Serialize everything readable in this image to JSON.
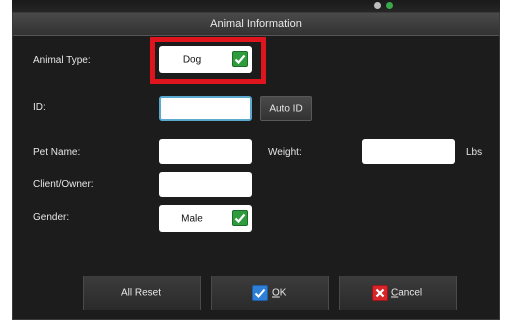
{
  "dialog": {
    "title": "Animal Information"
  },
  "labels": {
    "animal_type": "Animal Type:",
    "id": "ID:",
    "pet_name": "Pet Name:",
    "weight": "Weight:",
    "weight_unit": "Lbs",
    "client_owner": "Client/Owner:",
    "gender": "Gender:"
  },
  "fields": {
    "animal_type_value": "Dog",
    "id_value": "",
    "pet_name_value": "",
    "weight_value": "",
    "client_owner_value": "",
    "gender_value": "Male"
  },
  "buttons": {
    "auto_id": "Auto ID",
    "all_reset": "All Reset",
    "ok_accel": "O",
    "ok_rest": "K",
    "cancel_accel": "C",
    "cancel_rest": "ancel"
  },
  "icons": {
    "confirm": "checkmark-icon",
    "ok": "checkmark-icon",
    "cancel": "x-icon"
  },
  "colors": {
    "highlight": "#e0141c",
    "confirm_green": "#2e9b3c",
    "ok_blue": "#2f7fd6",
    "cancel_red": "#d6262a",
    "focus": "#5aa9cf"
  }
}
